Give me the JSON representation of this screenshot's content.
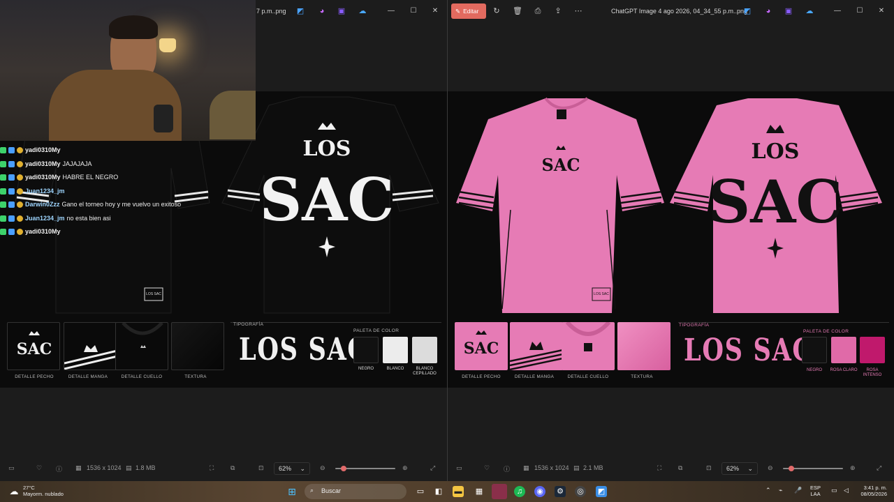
{
  "left_window": {
    "title": "7 p.m..png",
    "image_info": {
      "dimensions": "1536 x 1024",
      "size": "1.8 MB"
    },
    "zoom": "62%",
    "thumbs": [
      "DETALLE PECHO",
      "DETALLE MANGA",
      "DETALLE CUELLO",
      "TEXTURA"
    ],
    "typography_label": "TIPOGRAFÍA",
    "typography_text": "LOS SAC",
    "palette_label": "PALETA DE COLOR",
    "palette": [
      {
        "name": "NEGRO",
        "color": "#111111"
      },
      {
        "name": "BLANCO",
        "color": "#ececec"
      },
      {
        "name": "BLANCO CEPILLADO",
        "color": "#dcdcdc"
      }
    ],
    "chest_tag": "LOS SAC",
    "back_logo_top": "LOS",
    "back_logo_main": "SAC",
    "colors": {
      "shirt": "#0d0d0d",
      "ink": "#f2f2f2"
    }
  },
  "right_window": {
    "edit_label": "Editar",
    "title": "ChatGPT Image 4 ago 2026, 04_34_55 p.m..png",
    "image_info": {
      "dimensions": "1536 x 1024",
      "size": "2.1 MB"
    },
    "zoom": "62%",
    "thumbs": [
      "DETALLE PECHO",
      "DETALLE MANGA",
      "DETALLE CUELLO",
      "TEXTURA"
    ],
    "typography_label": "TIPOGRAFÍA",
    "typography_text": "LOS SAC",
    "palette_label": "PALETA DE COLOR",
    "palette": [
      {
        "name": "NEGRO",
        "color": "#111111"
      },
      {
        "name": "ROSA CLARO",
        "color": "#e06aa8"
      },
      {
        "name": "ROSA INTENSO",
        "color": "#c0196c"
      }
    ],
    "chest_tag": "LOS SAC",
    "back_logo_top": "LOS",
    "back_logo_main": "SAC",
    "colors": {
      "shirt": "#e67bb5",
      "ink": "#111111"
    }
  },
  "chat": [
    {
      "user": "yadi0310My",
      "msg": "",
      "color": "#f0f0f0"
    },
    {
      "user": "yadi0310My",
      "msg": "JAJAJAJA",
      "color": "#f0f0f0"
    },
    {
      "user": "yadi0310My",
      "msg": "HABRE EL NEGRO",
      "color": "#f0f0f0"
    },
    {
      "user": "Juan1234_jm",
      "msg": "",
      "color": "#9fd6ff"
    },
    {
      "user": "Darwin0Zzz",
      "msg": "Gano el torneo hoy y me vuelvo un exitoso",
      "color": "#9fd6ff"
    },
    {
      "user": "Juan1234_jm",
      "msg": "no esta bien asi",
      "color": "#9fd6ff"
    },
    {
      "user": "yadi0310My",
      "msg": "",
      "color": "#f0f0f0"
    }
  ],
  "taskbar": {
    "weather_temp": "27°C",
    "weather_desc": "Mayorm. nublado",
    "search_placeholder": "Buscar",
    "lang_top": "ESP",
    "lang_bottom": "LAA",
    "time": "3:41 p. m.",
    "date": "08/05/2026"
  }
}
